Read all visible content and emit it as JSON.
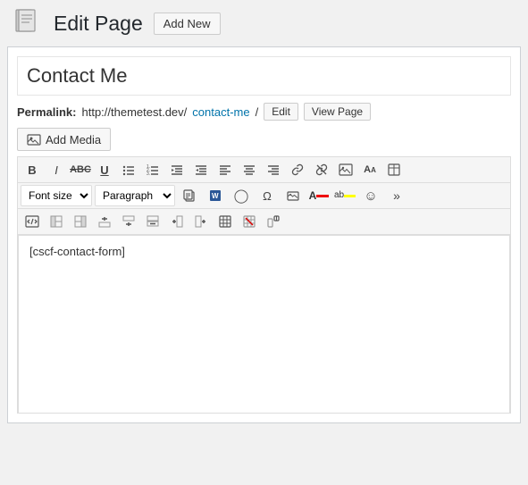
{
  "header": {
    "icon": "📄",
    "title": "Edit Page",
    "add_new_label": "Add New"
  },
  "editor": {
    "post_title": "Contact Me",
    "permalink": {
      "label": "Permalink:",
      "base_url": "http://themetest.dev/",
      "slug": "contact-me",
      "trailing_slash": "/",
      "edit_label": "Edit",
      "view_label": "View Page"
    },
    "add_media_label": "Add Media",
    "content": "[cscf-contact-form]"
  },
  "toolbar": {
    "row1": {
      "buttons": [
        {
          "name": "bold",
          "label": "B",
          "title": "Bold"
        },
        {
          "name": "italic",
          "label": "I",
          "title": "Italic"
        },
        {
          "name": "strikethrough",
          "label": "ABC",
          "title": "Strikethrough"
        },
        {
          "name": "underline",
          "label": "U",
          "title": "Underline"
        },
        {
          "name": "unordered-list",
          "label": "≡",
          "title": "Unordered List"
        },
        {
          "name": "ordered-list",
          "label": "≡#",
          "title": "Ordered List"
        },
        {
          "name": "outdent",
          "label": "⇤",
          "title": "Outdent"
        },
        {
          "name": "indent",
          "label": "⇥",
          "title": "Indent"
        },
        {
          "name": "align-left",
          "label": "≡",
          "title": "Align Left"
        },
        {
          "name": "align-center",
          "label": "≡",
          "title": "Align Center"
        },
        {
          "name": "align-right",
          "label": "≡",
          "title": "Align Right"
        },
        {
          "name": "link",
          "label": "🔗",
          "title": "Insert Link"
        },
        {
          "name": "unlink",
          "label": "🔗",
          "title": "Remove Link"
        },
        {
          "name": "insert-image",
          "label": "🖼",
          "title": "Insert Image"
        },
        {
          "name": "font-size-increase",
          "label": "A↑",
          "title": "Increase Font"
        },
        {
          "name": "table-layout",
          "label": "▦",
          "title": "Table"
        }
      ]
    },
    "row2": {
      "font_size_label": "Font size",
      "format_label": "Paragraph",
      "buttons": [
        {
          "name": "paste-text",
          "label": "📋",
          "title": "Paste as Text"
        },
        {
          "name": "paste-word",
          "label": "📝",
          "title": "Paste from Word"
        },
        {
          "name": "clear-format",
          "label": "◯",
          "title": "Clear Formatting"
        },
        {
          "name": "special-char",
          "label": "Ω",
          "title": "Special Characters"
        },
        {
          "name": "media-lib",
          "label": "🖼",
          "title": "Media Library"
        },
        {
          "name": "text-color",
          "label": "A",
          "title": "Text Color"
        },
        {
          "name": "bg-color",
          "label": "ab",
          "title": "Background Color"
        },
        {
          "name": "emoticon",
          "label": "☺",
          "title": "Emoticons"
        },
        {
          "name": "more",
          "label": "»",
          "title": "More"
        }
      ]
    },
    "row3": {
      "buttons": [
        {
          "name": "edit-html",
          "label": "✏",
          "title": "Edit HTML"
        },
        {
          "name": "btn-r2",
          "label": "▭",
          "title": ""
        },
        {
          "name": "btn-r3",
          "label": "▭",
          "title": ""
        },
        {
          "name": "btn-r4",
          "label": "↙",
          "title": ""
        },
        {
          "name": "btn-r5",
          "label": "↙",
          "title": ""
        },
        {
          "name": "btn-r6",
          "label": "↙",
          "title": ""
        },
        {
          "name": "btn-r7",
          "label": "◫",
          "title": ""
        },
        {
          "name": "btn-r8",
          "label": "▭",
          "title": ""
        },
        {
          "name": "btn-r9",
          "label": "▦",
          "title": ""
        },
        {
          "name": "btn-r10",
          "label": "▭",
          "title": ""
        },
        {
          "name": "btn-r11",
          "label": "↗",
          "title": ""
        }
      ]
    }
  }
}
